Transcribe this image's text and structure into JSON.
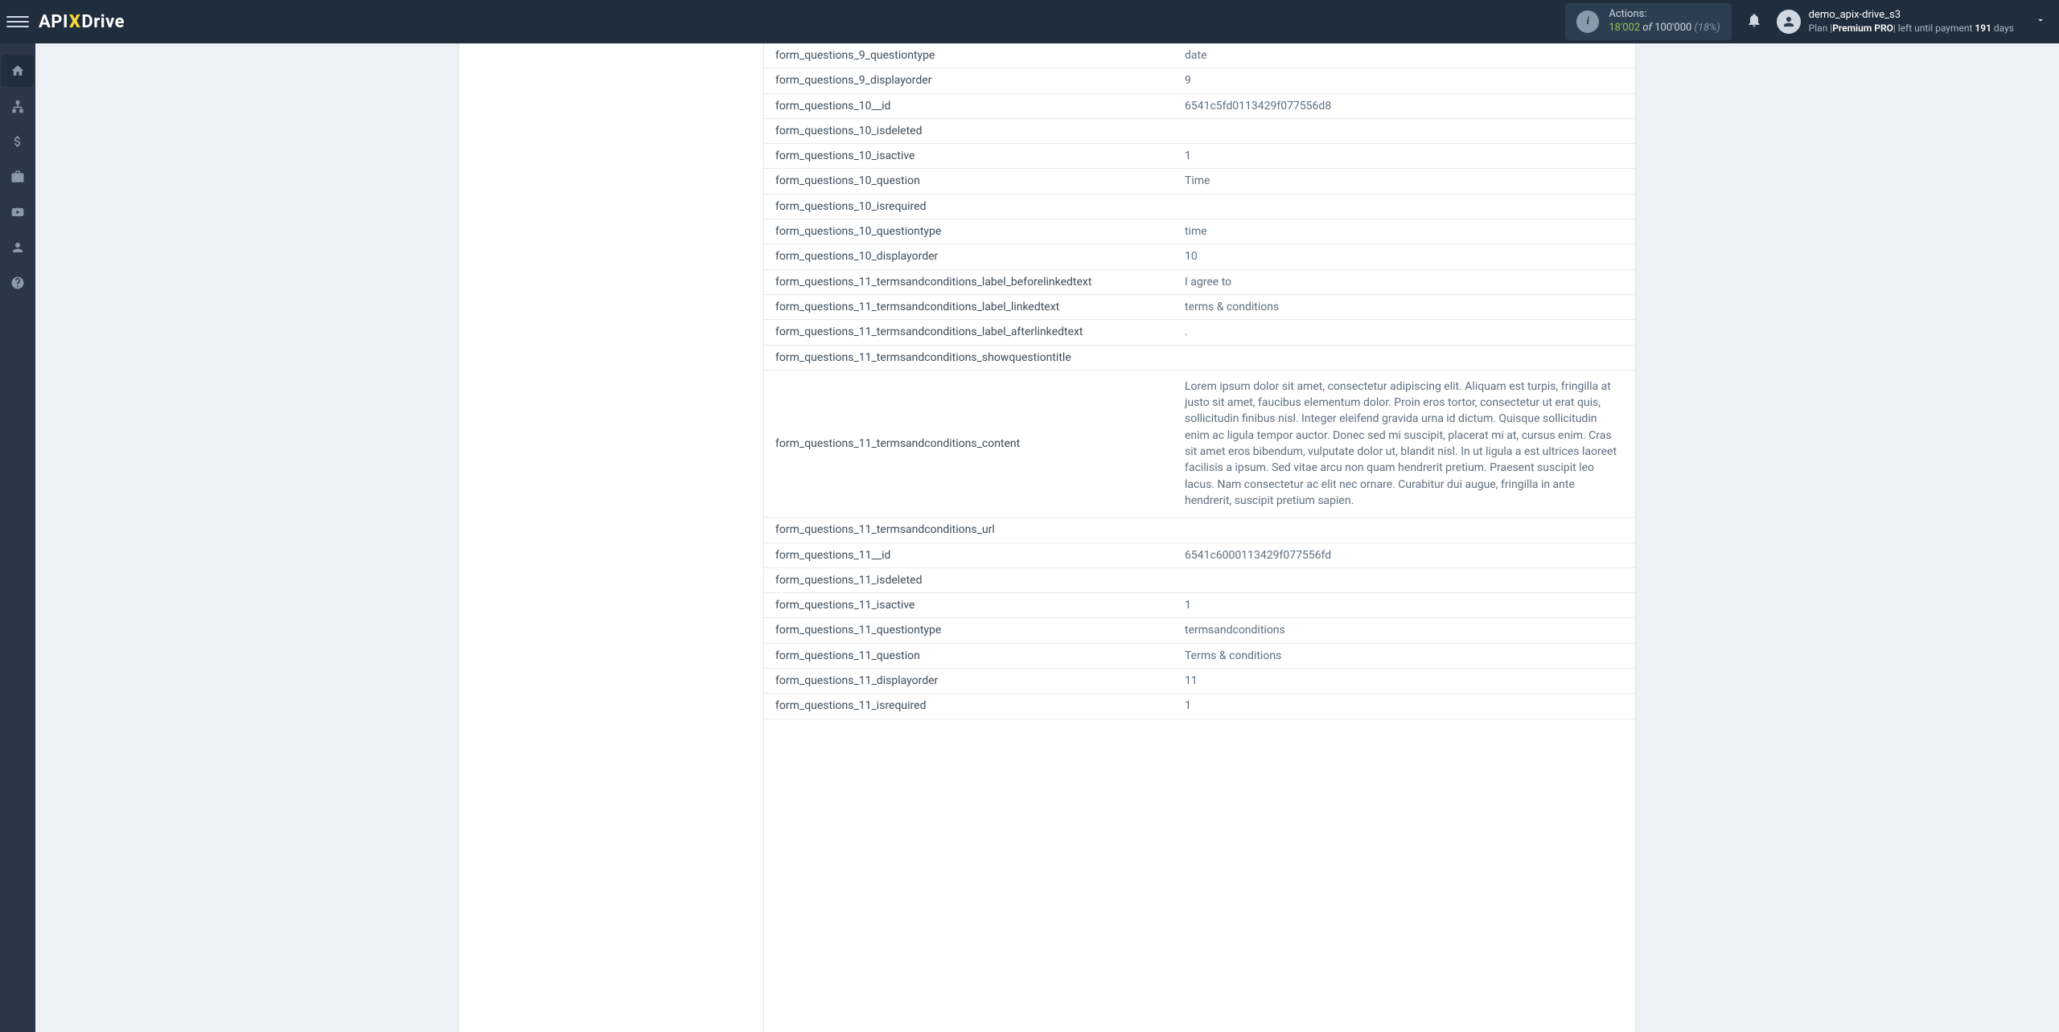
{
  "header": {
    "logo_api": "API",
    "logo_x": "X",
    "logo_drive": "Drive",
    "actions_label": "Actions:",
    "actions_used": "18'002",
    "actions_of": "of",
    "actions_total": "100'000",
    "actions_pct": "(18%)",
    "username": "demo_apix-drive_s3",
    "plan_prefix": "Plan |",
    "plan_name": "Premium PRO",
    "plan_mid": "| left until payment ",
    "plan_days": "191",
    "plan_suffix": " days"
  },
  "rows": [
    {
      "key": "form_questions_9_questiontype",
      "value": "date"
    },
    {
      "key": "form_questions_9_displayorder",
      "value": "9"
    },
    {
      "key": "form_questions_10__id",
      "value": "6541c5fd0113429f077556d8"
    },
    {
      "key": "form_questions_10_isdeleted",
      "value": ""
    },
    {
      "key": "form_questions_10_isactive",
      "value": "1"
    },
    {
      "key": "form_questions_10_question",
      "value": "Time"
    },
    {
      "key": "form_questions_10_isrequired",
      "value": ""
    },
    {
      "key": "form_questions_10_questiontype",
      "value": "time"
    },
    {
      "key": "form_questions_10_displayorder",
      "value": "10"
    },
    {
      "key": "form_questions_11_termsandconditions_label_beforelinkedtext",
      "value": "I agree to"
    },
    {
      "key": "form_questions_11_termsandconditions_label_linkedtext",
      "value": "terms & conditions"
    },
    {
      "key": "form_questions_11_termsandconditions_label_afterlinkedtext",
      "value": "."
    },
    {
      "key": "form_questions_11_termsandconditions_showquestiontitle",
      "value": ""
    },
    {
      "key": "form_questions_11_termsandconditions_content",
      "value": "Lorem ipsum dolor sit amet, consectetur adipiscing elit. Aliquam est turpis, fringilla at justo sit amet, faucibus elementum dolor. Proin eros tortor, consectetur ut erat quis, sollicitudin finibus nisl. Integer eleifend gravida urna id dictum. Quisque sollicitudin enim ac ligula tempor auctor. Donec sed mi suscipit, placerat mi at, cursus enim. Cras sit amet eros bibendum, vulputate dolor ut, blandit nisl. In ut ligula a est ultrices laoreet facilisis a ipsum. Sed vitae arcu non quam hendrerit pretium. Praesent suscipit leo lacus. Nam consectetur ac elit nec ornare. Curabitur dui augue, fringilla in ante hendrerit, suscipit pretium sapien.",
      "tall": true
    },
    {
      "key": "form_questions_11_termsandconditions_url",
      "value": ""
    },
    {
      "key": "form_questions_11__id",
      "value": "6541c6000113429f077556fd"
    },
    {
      "key": "form_questions_11_isdeleted",
      "value": ""
    },
    {
      "key": "form_questions_11_isactive",
      "value": "1"
    },
    {
      "key": "form_questions_11_questiontype",
      "value": "termsandconditions"
    },
    {
      "key": "form_questions_11_question",
      "value": "Terms & conditions"
    },
    {
      "key": "form_questions_11_displayorder",
      "value": "11"
    },
    {
      "key": "form_questions_11_isrequired",
      "value": "1"
    }
  ]
}
